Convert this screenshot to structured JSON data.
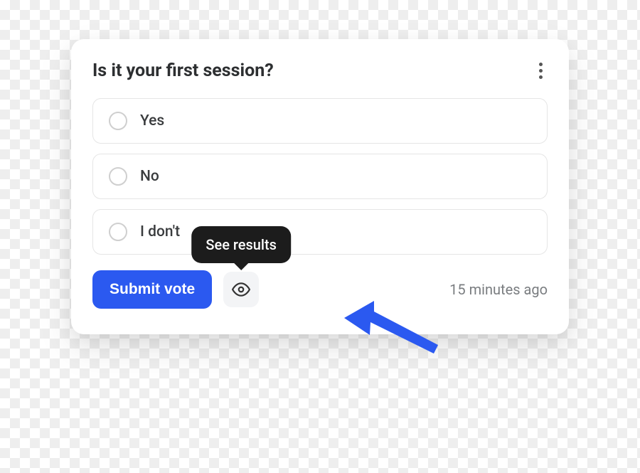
{
  "poll": {
    "title": "Is it your first session?",
    "options": [
      {
        "label": "Yes"
      },
      {
        "label": "No"
      },
      {
        "label": "I don't"
      }
    ],
    "submit_label": "Submit vote",
    "see_results_tooltip": "See results",
    "timestamp": "15 minutes ago"
  },
  "colors": {
    "accent": "#2b59f0",
    "tooltip_bg": "#1c1c1c",
    "text_muted": "#7a7d80"
  }
}
